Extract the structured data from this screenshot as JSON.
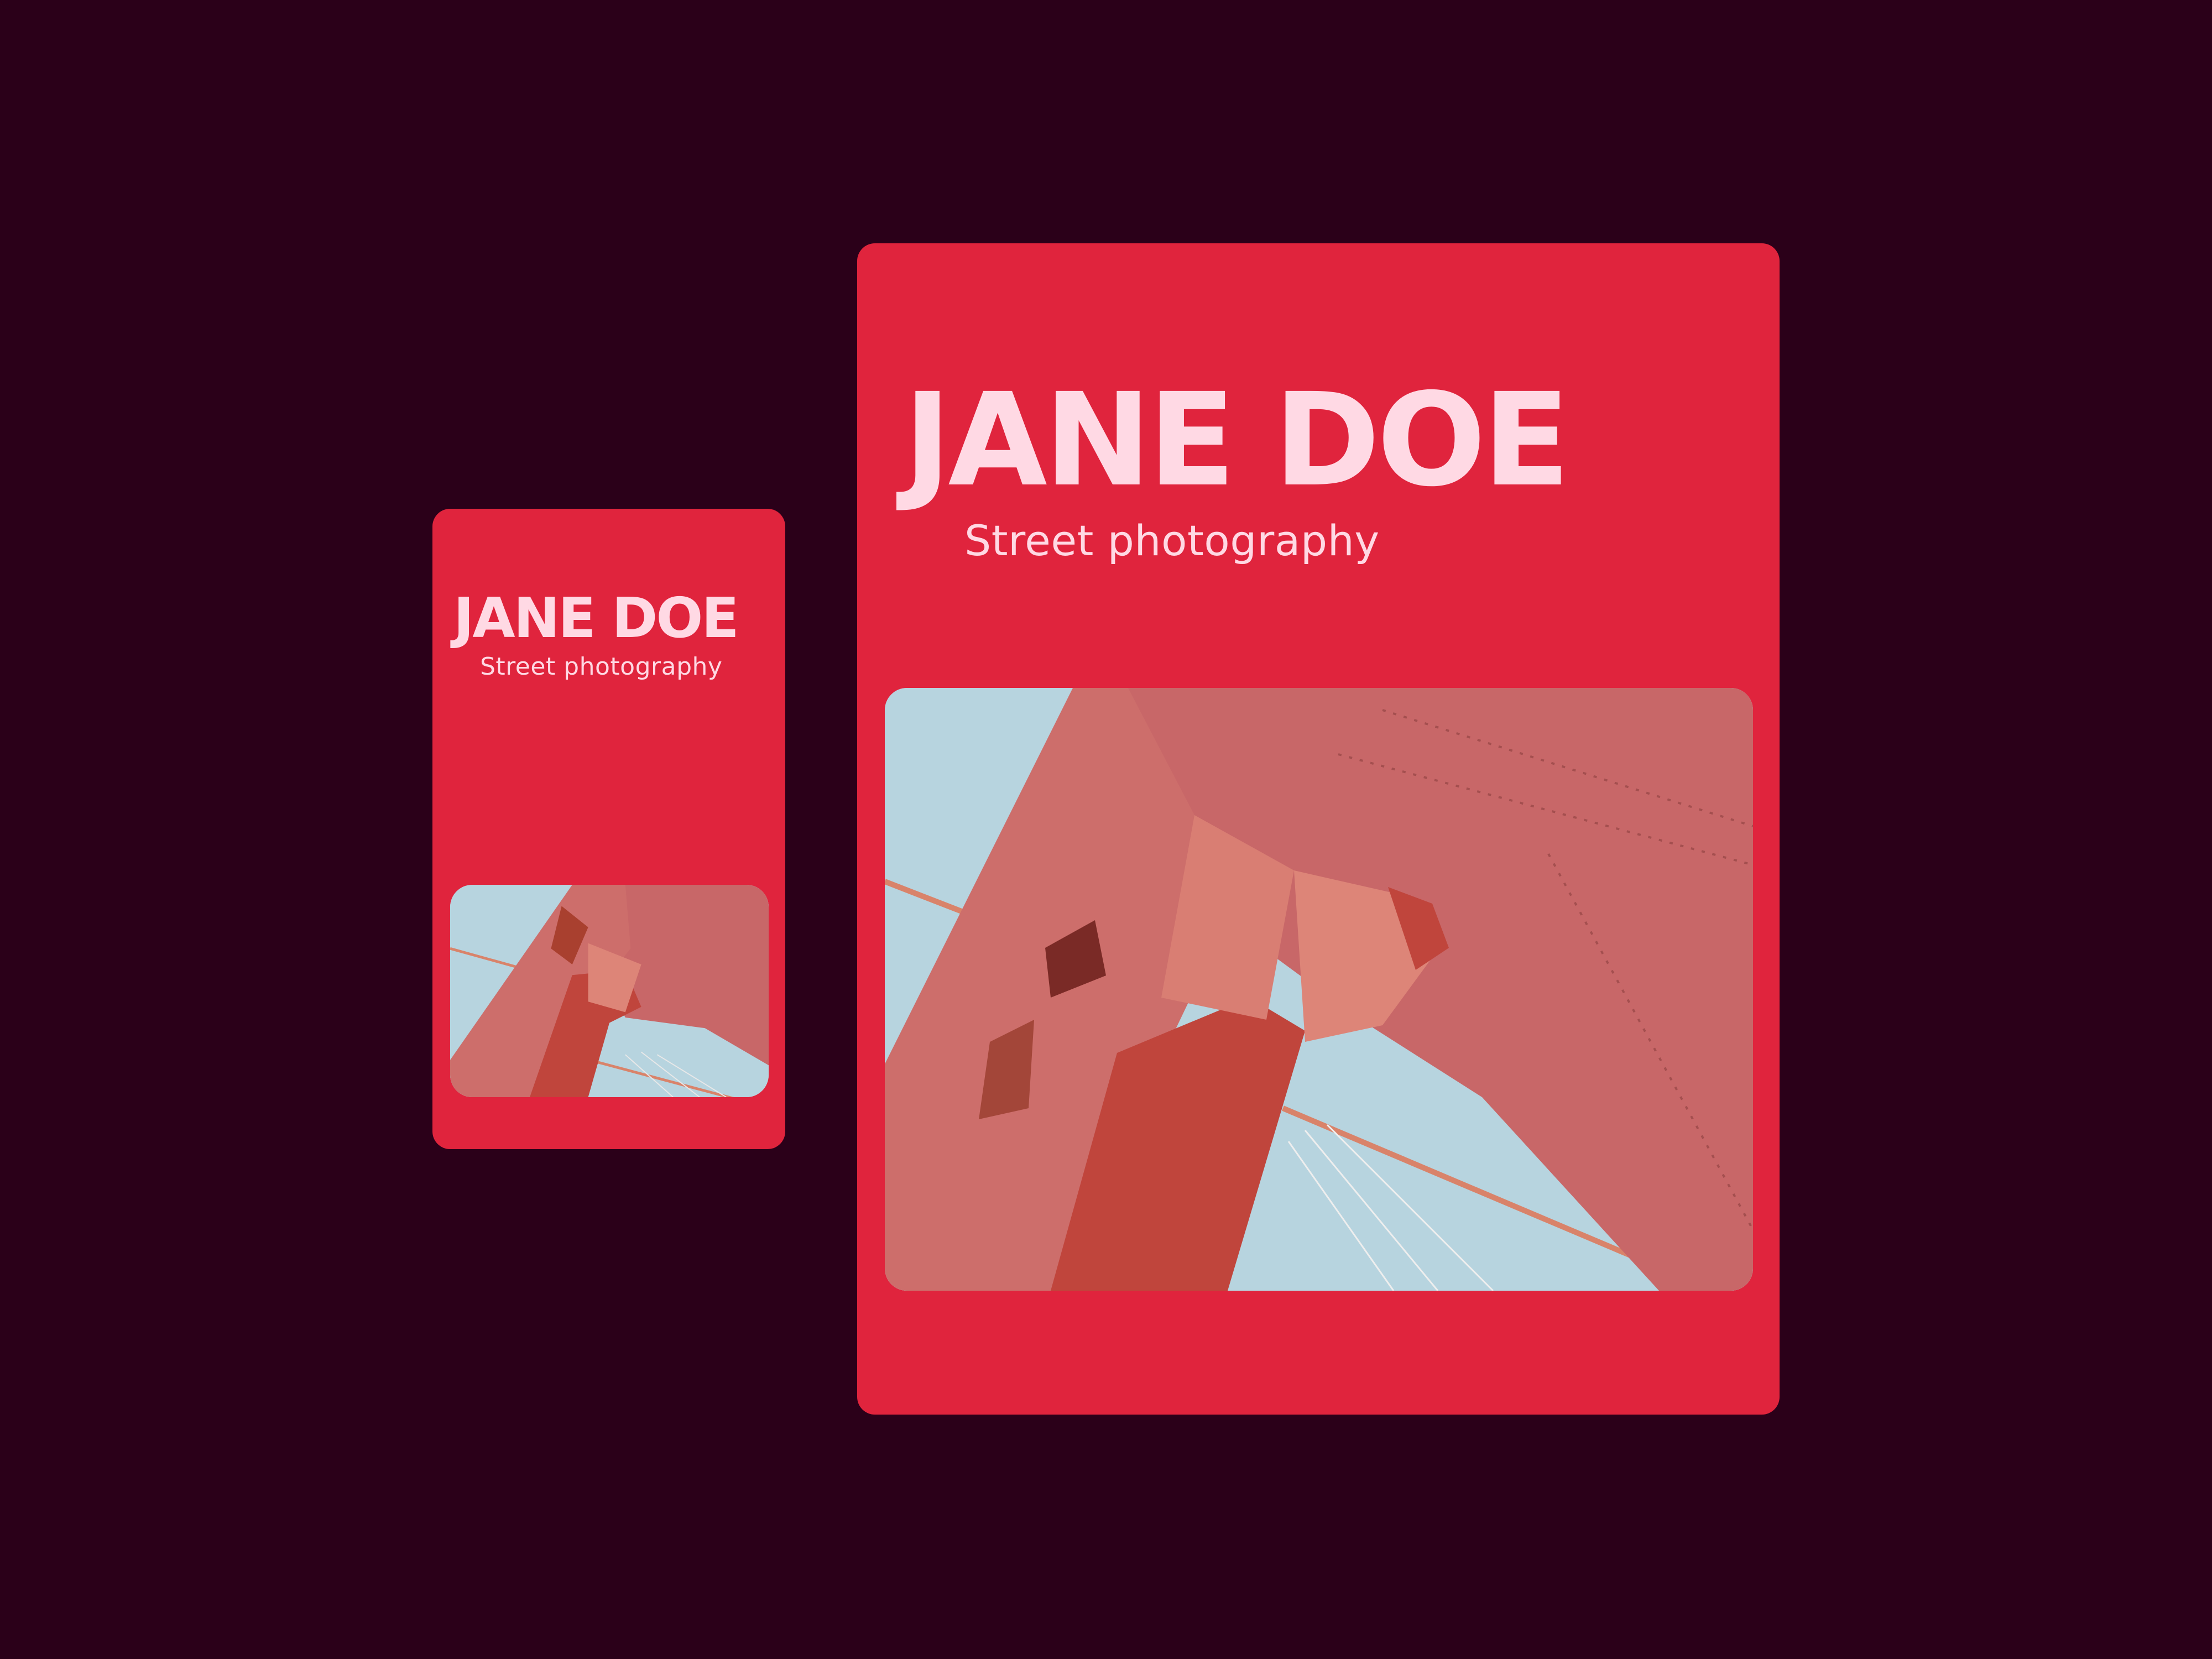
{
  "colors": {
    "background": "#2b0019",
    "card": "#e0243d",
    "text": "#ffd9e4",
    "sky": "#b7d4df",
    "bridge": "#c9595f"
  },
  "mobile_card": {
    "name": "JANE DOE",
    "subtitle": "Street photography"
  },
  "desktop_card": {
    "name": "JANE DOE",
    "subtitle": "Street photography"
  }
}
